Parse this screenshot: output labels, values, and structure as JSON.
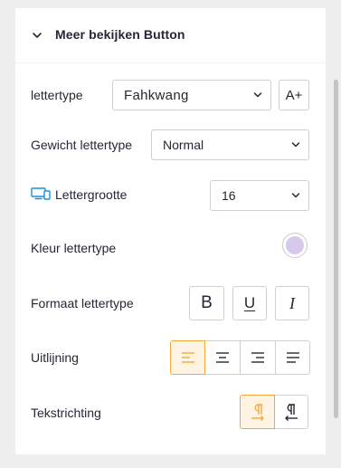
{
  "section": {
    "title": "Meer bekijken Button",
    "expanded": true
  },
  "font_family": {
    "label": "lettertype",
    "value": "Fahkwang",
    "add_font_icon": "A+"
  },
  "font_weight": {
    "label": "Gewicht lettertype",
    "value": "Normal"
  },
  "font_size": {
    "label": "Lettergrootte",
    "value": "16",
    "device_icon": "desktop-mobile-icon"
  },
  "font_color": {
    "label": "Kleur lettertype",
    "swatch_color": "#d8c8ec"
  },
  "font_format": {
    "label": "Formaat lettertype",
    "bold_glyph": "B",
    "underline_glyph": "U",
    "italic_glyph": "I"
  },
  "alignment": {
    "label": "Uitlijning",
    "options": [
      "left",
      "center",
      "right",
      "justify"
    ],
    "selected": "left"
  },
  "text_direction": {
    "label": "Tekstrichting",
    "options": [
      "ltr",
      "rtl"
    ],
    "selected": "ltr"
  },
  "colors": {
    "accent": "#f4a83a",
    "accent_bg": "#fff4e3",
    "device_icon": "#1a8fe0"
  }
}
